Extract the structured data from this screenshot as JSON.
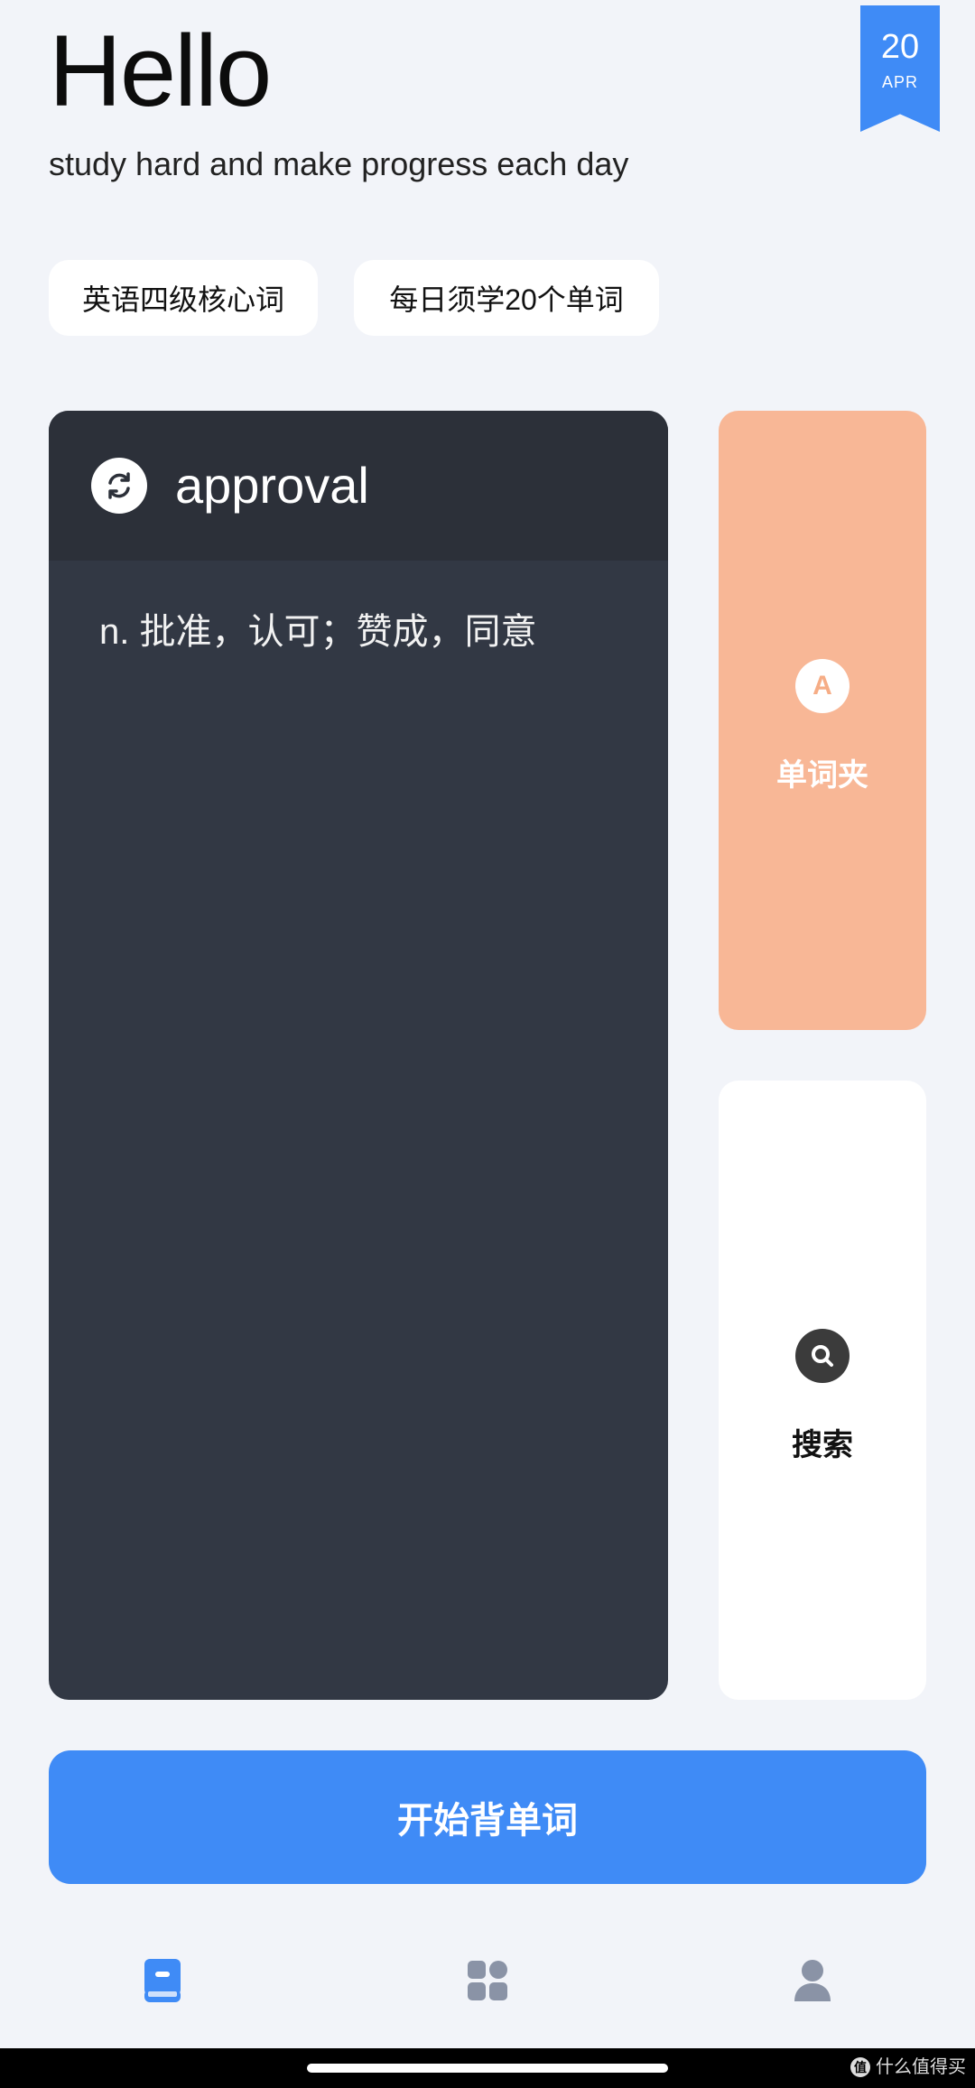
{
  "header": {
    "title": "Hello",
    "subtitle": "study hard and make progress each day"
  },
  "date_badge": {
    "day": "20",
    "month": "APR",
    "color": "#3f8bf6"
  },
  "tags": [
    {
      "label": "英语四级核心词"
    },
    {
      "label": "每日须学20个单词"
    }
  ],
  "word_card": {
    "icon": "refresh-icon",
    "word": "approval",
    "meaning": "n. 批准，认可；赞成，同意",
    "background": "#323844"
  },
  "tiles": {
    "folder": {
      "icon": "letter-a-icon",
      "icon_text": "A",
      "label": "单词夹",
      "color": "#f8b796"
    },
    "search": {
      "icon": "search-icon",
      "label": "搜索",
      "color": "#ffffff"
    }
  },
  "start_button": {
    "label": "开始背单词",
    "color": "#3f8bf6"
  },
  "bottom_nav": [
    {
      "icon": "book-icon",
      "active": true,
      "color": "#3f8bf6"
    },
    {
      "icon": "grid-icon",
      "active": false,
      "color": "#8a93a6"
    },
    {
      "icon": "user-icon",
      "active": false,
      "color": "#8a93a6"
    }
  ],
  "watermark": {
    "mark": "值",
    "text": "什么值得买"
  }
}
